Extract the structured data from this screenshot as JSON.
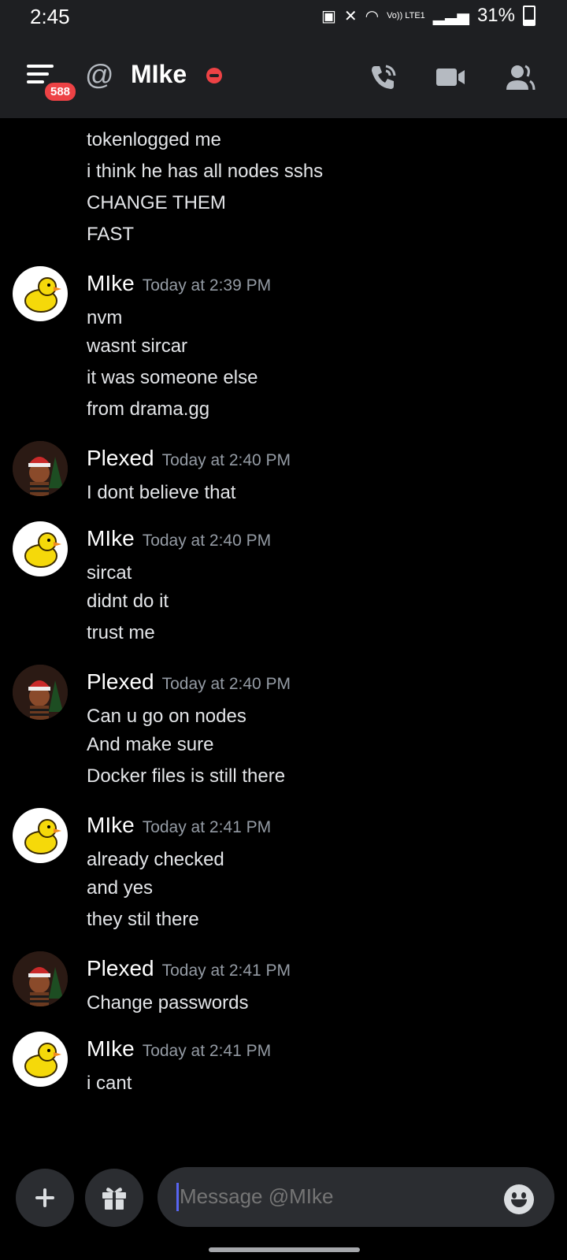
{
  "status_bar": {
    "time": "2:45",
    "battery_percent": "31%",
    "network": "Vo)) LTE1"
  },
  "header": {
    "mention_badge": "588",
    "channel_name": "MIke"
  },
  "composer": {
    "placeholder": "Message @MIke"
  },
  "messages": {
    "m0": {
      "lines": [
        "tokenlogged me",
        "i think he has all nodes sshs",
        "CHANGE THEM",
        "FAST"
      ]
    },
    "m1": {
      "author": "MIke",
      "timestamp": "Today at 2:39 PM",
      "lines": [
        "nvm",
        "wasnt sircar",
        "it was someone else",
        "from drama.gg"
      ]
    },
    "m2": {
      "author": "Plexed",
      "timestamp": "Today at 2:40 PM",
      "lines": [
        "I dont believe that"
      ]
    },
    "m3": {
      "author": "MIke",
      "timestamp": "Today at 2:40 PM",
      "lines": [
        "sircat",
        "didnt do it",
        "trust me"
      ]
    },
    "m4": {
      "author": "Plexed",
      "timestamp": "Today at 2:40 PM",
      "lines": [
        "Can u go on nodes",
        "And make sure",
        "Docker files is still there"
      ]
    },
    "m5": {
      "author": "MIke",
      "timestamp": "Today at 2:41 PM",
      "lines": [
        "already checked",
        "and yes",
        "they stil there"
      ]
    },
    "m6": {
      "author": "Plexed",
      "timestamp": "Today at 2:41 PM",
      "lines": [
        "Change passwords"
      ]
    },
    "m7": {
      "author": "MIke",
      "timestamp": "Today at 2:41 PM",
      "lines": [
        "i cant"
      ]
    }
  }
}
